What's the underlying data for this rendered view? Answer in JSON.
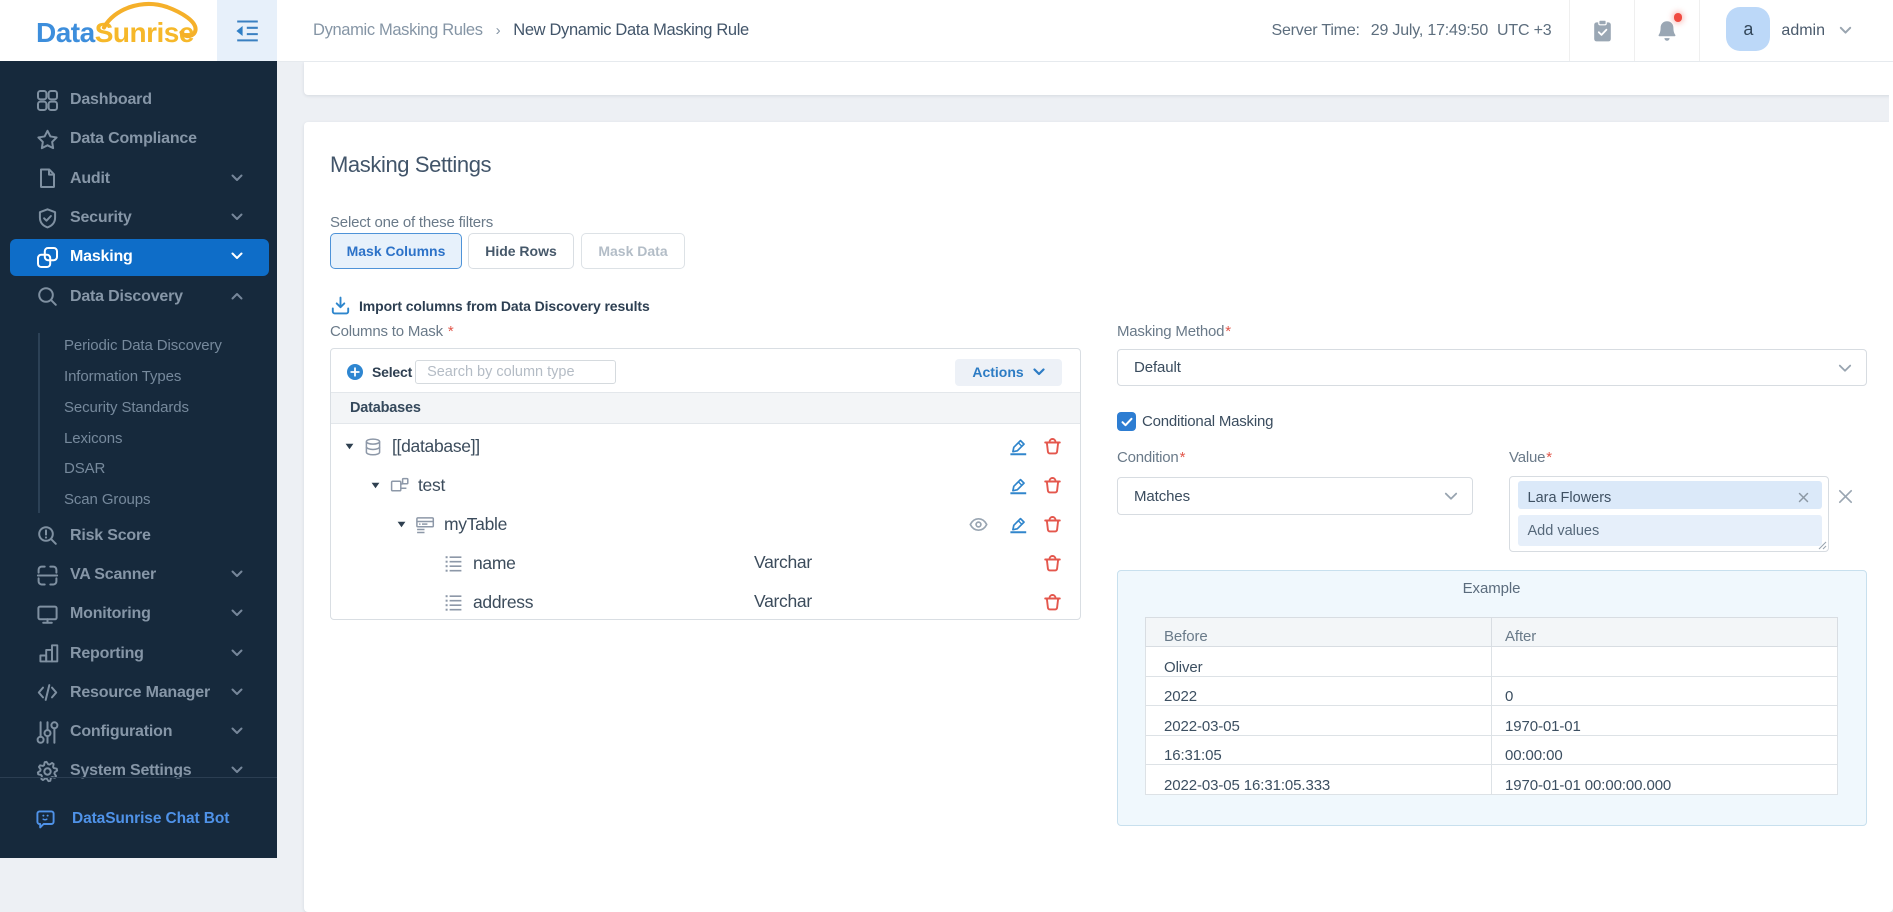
{
  "sidebar": {
    "logo": {
      "part1": "Data",
      "part2": "Sunrise"
    },
    "items": [
      {
        "label": "Dashboard",
        "icon": "dashboard-icon"
      },
      {
        "label": "Data Compliance",
        "icon": "star-icon"
      },
      {
        "label": "Audit",
        "icon": "file-icon",
        "chevron": "down"
      },
      {
        "label": "Security",
        "icon": "shield-check-icon",
        "chevron": "down"
      },
      {
        "label": "Masking",
        "icon": "masking-icon",
        "chevron": "down",
        "selected": true
      },
      {
        "label": "Data Discovery",
        "icon": "search-icon",
        "chevron": "up",
        "expanded": true
      }
    ],
    "data_discovery_subitems": [
      "Periodic Data Discovery",
      "Information Types",
      "Security Standards",
      "Lexicons",
      "DSAR",
      "Scan Groups"
    ],
    "items_lower": [
      {
        "label": "Risk Score",
        "icon": "risk-score-icon"
      },
      {
        "label": "VA Scanner",
        "icon": "va-scanner-icon",
        "chevron": "down"
      },
      {
        "label": "Monitoring",
        "icon": "monitor-icon",
        "chevron": "down"
      },
      {
        "label": "Reporting",
        "icon": "bar-chart-icon",
        "chevron": "down"
      },
      {
        "label": "Resource Manager",
        "icon": "code-icon",
        "chevron": "down"
      },
      {
        "label": "Configuration",
        "icon": "sliders-icon",
        "chevron": "down"
      },
      {
        "label": "System Settings",
        "icon": "gear-icon",
        "chevron": "down"
      }
    ],
    "chatbot_label": "DataSunrise Chat Bot"
  },
  "header": {
    "breadcrumb": {
      "parent": "Dynamic Masking Rules",
      "separator": "›",
      "current": "New Dynamic Data Masking Rule"
    },
    "server_time_label": "Server Time:",
    "server_time_value": "29 July, 17:49:50",
    "server_time_zone": "UTC +3",
    "user": {
      "avatar_letter": "a",
      "name": "admin"
    }
  },
  "masking_settings": {
    "title": "Masking Settings",
    "required_marker": "*",
    "filter_label": "Select one of these filters",
    "filters": [
      {
        "label": "Mask Columns",
        "state": "active"
      },
      {
        "label": "Hide Rows",
        "state": "default"
      },
      {
        "label": "Mask Data",
        "state": "disabled"
      }
    ],
    "import_link": "Import columns from Data Discovery results",
    "columns_to_mask_label": "Columns to Mask",
    "tree_toolbar": {
      "select_label": "Select",
      "search_placeholder": "Search by column type",
      "actions_label": "Actions"
    },
    "tree_header": "Databases",
    "tree": [
      {
        "name": "[[database]]",
        "type": "database",
        "depth": 0
      },
      {
        "name": "test",
        "type": "schema",
        "depth": 1
      },
      {
        "name": "myTable",
        "type": "table",
        "depth": 2
      },
      {
        "name": "name",
        "type": "column",
        "datatype": "Varchar",
        "depth": 3
      },
      {
        "name": "address",
        "type": "column",
        "datatype": "Varchar",
        "depth": 3
      }
    ],
    "masking_method_label": "Masking Method",
    "masking_method_value": "Default",
    "conditional_masking_label": "Conditional Masking",
    "conditional_masking_checked": true,
    "condition_label": "Condition",
    "condition_value": "Matches",
    "value_label": "Value",
    "value_tags": [
      "Lara Flowers"
    ],
    "add_values_placeholder": "Add values",
    "example": {
      "title": "Example",
      "columns": [
        "Before",
        "After"
      ],
      "rows": [
        [
          "Oliver",
          ""
        ],
        [
          "2022",
          "0"
        ],
        [
          "2022-03-05",
          "1970-01-01"
        ],
        [
          "16:31:05",
          "00:00:00"
        ],
        [
          "2022-03-05 16:31:05.333",
          "1970-01-01 00:00:00.000"
        ]
      ]
    }
  }
}
